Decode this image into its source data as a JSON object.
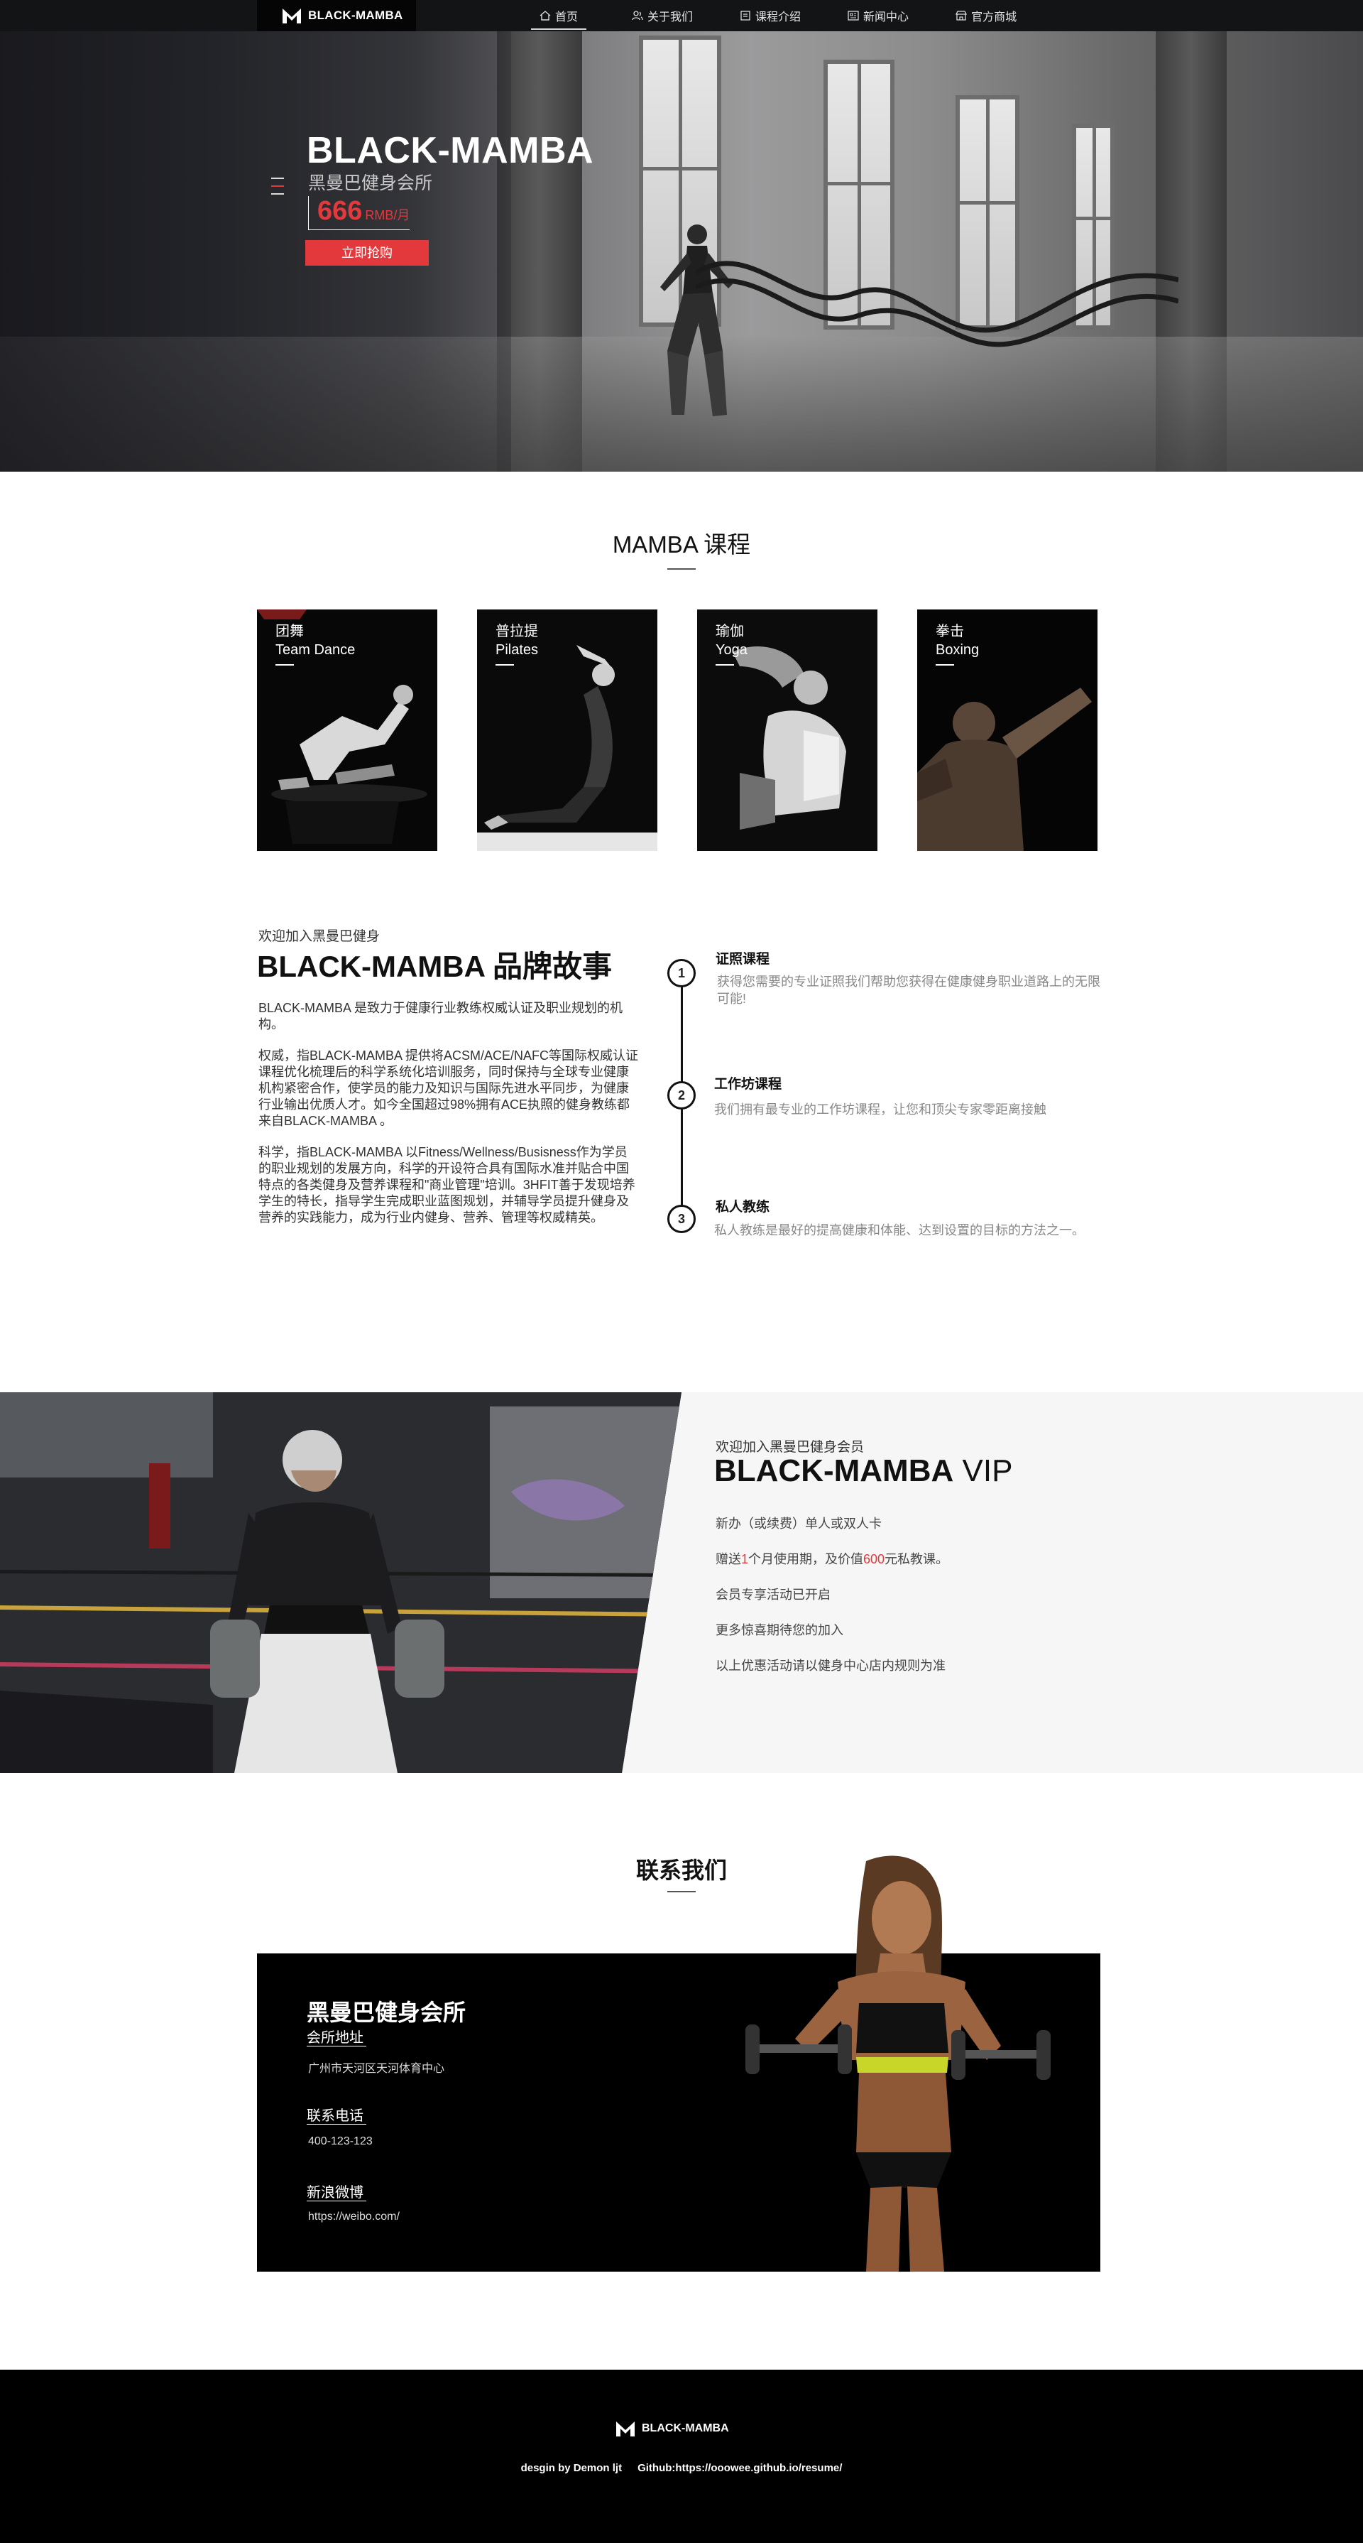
{
  "nav": {
    "logo_text": "BLACK-MAMBA",
    "items": [
      {
        "label": "首页",
        "icon": "home-icon"
      },
      {
        "label": "关于我们",
        "icon": "users-icon"
      },
      {
        "label": "课程介绍",
        "icon": "book-icon"
      },
      {
        "label": "新闻中心",
        "icon": "news-icon"
      },
      {
        "label": "官方商城",
        "icon": "shop-icon"
      }
    ]
  },
  "hero": {
    "title": "BLACK-MAMBA",
    "subtitle": "黑曼巴健身会所",
    "price": "666",
    "price_unit": "RMB/月",
    "button": "立即抢购"
  },
  "courses": {
    "title": "MAMBA 课程",
    "items": [
      {
        "cn": "团舞",
        "en": "Team Dance"
      },
      {
        "cn": "普拉提",
        "en": "Pilates"
      },
      {
        "cn": "瑜伽",
        "en": "Yoga"
      },
      {
        "cn": "拳击",
        "en": "Boxing"
      }
    ]
  },
  "story": {
    "welcome": "欢迎加入黑曼巴健身",
    "title": "BLACK-MAMBA 品牌故事",
    "paragraphs": [
      "BLACK-MAMBA 是致力于健康行业教练权威认证及职业规划的机构。",
      "权威，指BLACK-MAMBA 提供将ACSM/ACE/NAFC等国际权威认证课程优化梳理后的科学系统化培训服务，同时保持与全球专业健康机构紧密合作，使学员的能力及知识与国际先进水平同步，为健康行业输出优质人才。如今全国超过98%拥有ACE执照的健身教练都来自BLACK-MAMBA 。",
      "科学，指BLACK-MAMBA 以Fitness/Wellness/Busisness作为学员的职业规划的发展方向，科学的开设符合具有国际水准并贴合中国特点的各类健身及营养课程和\"商业管理\"培训。3HFIT善于发现培养学生的特长，指导学生完成职业蓝图规划，并辅导学员提升健身及营养的实践能力，成为行业内健身、营养、管理等权威精英。"
    ],
    "timeline": [
      {
        "num": "1",
        "title": "证照课程",
        "text": "获得您需要的专业证照我们帮助您获得在健康健身职业道路上的无限可能!"
      },
      {
        "num": "2",
        "title": "工作坊课程",
        "text": "我们拥有最专业的工作坊课程，让您和顶尖专家零距离接触"
      },
      {
        "num": "3",
        "title": "私人教练",
        "text": "私人教练是最好的提高健康和体能、达到设置的目标的方法之一。"
      }
    ]
  },
  "vip": {
    "welcome": "欢迎加入黑曼巴健身会员",
    "title_bold": "BLACK-MAMBA",
    "title_rest": " VIP",
    "item1": "新办（或续费）单人或双人卡",
    "item2_a": "赠送",
    "item2_red1": "1",
    "item2_b": "个月使用期，及价值",
    "item2_red2": "600",
    "item2_c": "元私教课。",
    "item3": "会员专享活动已开启",
    "item4": "更多惊喜期待您的加入",
    "item5": "以上优惠活动请以健身中心店内规则为准"
  },
  "contact": {
    "title": "联系我们",
    "name": "黑曼巴健身会所",
    "address_label": "会所地址",
    "address": "广州市天河区天河体育中心",
    "phone_label": "联系电话",
    "phone": "400-123-123",
    "weibo_label": "新浪微博",
    "weibo": "https://weibo.com/"
  },
  "footer": {
    "logo_text": "BLACK-MAMBA",
    "credit_design": "desgin by Demon ljt",
    "credit_github": "Github:https://ooowee.github.io/resume/"
  },
  "colors": {
    "accent_red": "#e4393c",
    "nav_bg": "#131416",
    "footer_bg": "#000000"
  }
}
